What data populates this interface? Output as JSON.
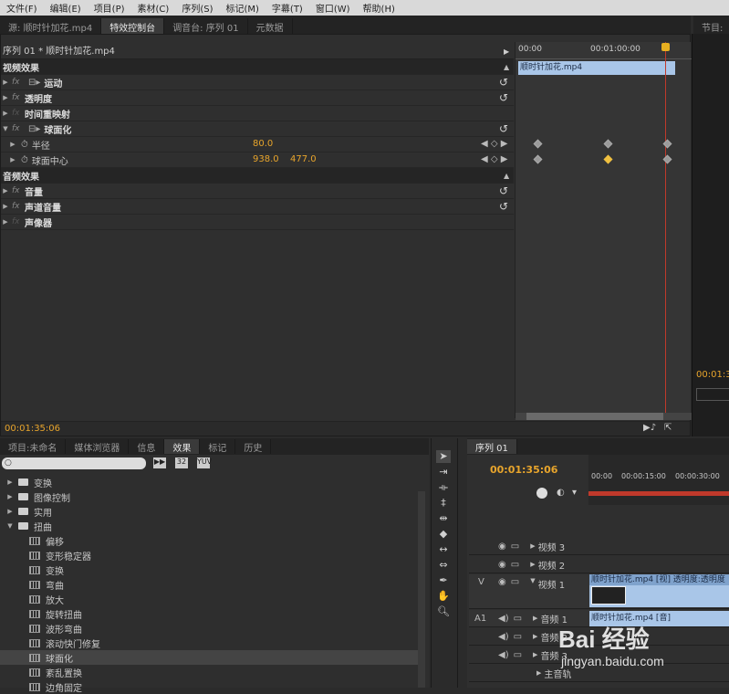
{
  "menu": [
    "文件(F)",
    "编辑(E)",
    "项目(P)",
    "素材(C)",
    "序列(S)",
    "标记(M)",
    "字幕(T)",
    "窗口(W)",
    "帮助(H)"
  ],
  "top_tabs": {
    "source": "源: 顺时针加花.mp4",
    "effect_controls": "特效控制台",
    "mixer": "调音台: 序列 01",
    "metadata": "元数据",
    "program": "节目:"
  },
  "effect_controls": {
    "clip_label": "序列 01 * 顺时针加花.mp4",
    "ruler": [
      "00:00",
      "00:01:00:00"
    ],
    "clip_bar_label": "顺时针加花.mp4",
    "video_effects": "视频效果",
    "effects": [
      {
        "name": "运动"
      },
      {
        "name": "透明度"
      },
      {
        "name": "时间重映射"
      },
      {
        "name": "球面化"
      }
    ],
    "params": [
      {
        "name": "半径",
        "v1": "80.0",
        "v2": ""
      },
      {
        "name": "球面中心",
        "v1": "938.0",
        "v2": "477.0"
      }
    ],
    "audio_effects": "音频效果",
    "audio": [
      {
        "name": "音量"
      },
      {
        "name": "声道音量"
      },
      {
        "name": "声像器"
      }
    ],
    "timecode": "00:01:35:06"
  },
  "program_timecode": "00:01:3",
  "project_tabs": [
    "项目:未命名",
    "媒体浏览器",
    "信息",
    "效果",
    "标记",
    "历史"
  ],
  "effects_tree": [
    {
      "label": "变换",
      "type": "folder",
      "open": false
    },
    {
      "label": "图像控制",
      "type": "folder",
      "open": false
    },
    {
      "label": "实用",
      "type": "folder",
      "open": false
    },
    {
      "label": "扭曲",
      "type": "folder",
      "open": true
    },
    {
      "label": "偏移",
      "type": "effect"
    },
    {
      "label": "变形稳定器",
      "type": "effect"
    },
    {
      "label": "变换",
      "type": "effect"
    },
    {
      "label": "弯曲",
      "type": "effect"
    },
    {
      "label": "放大",
      "type": "effect"
    },
    {
      "label": "旋转扭曲",
      "type": "effect"
    },
    {
      "label": "波形弯曲",
      "type": "effect"
    },
    {
      "label": "滚动快门修复",
      "type": "effect"
    },
    {
      "label": "球面化",
      "type": "effect",
      "selected": true
    },
    {
      "label": "紊乱置换",
      "type": "effect"
    },
    {
      "label": "边角固定",
      "type": "effect"
    }
  ],
  "sequence": {
    "tab": "序列 01",
    "timecode": "00:01:35:06",
    "ruler": [
      "00:00",
      "00:00:15:00",
      "00:00:30:00"
    ],
    "tracks": [
      "视频 3",
      "视频 2",
      "视频 1",
      "音频 1",
      "音频 2",
      "音频 3",
      "主音轨"
    ],
    "v_label": "V",
    "a_label": "A1",
    "video_clip": "顺时针加花.mp4 [视] 透明度:透明度",
    "audio_clip": "顺时针加花.mp4 [音]"
  },
  "watermark": {
    "brand": "Bai 经验",
    "url": "jingyan.baidu.com"
  }
}
